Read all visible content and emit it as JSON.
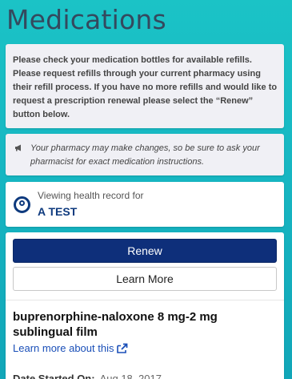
{
  "page": {
    "title": "Medications"
  },
  "notice": {
    "text": "Please check your medication bottles for available refills. Please request refills through your current pharmacy using their refill process. If you have no more refills and would like to request a prescription renewal please select the “Renew” button below."
  },
  "pharmacy_note": {
    "icon": "megaphone-icon",
    "text": "Your pharmacy may make changes, so be sure to ask your pharmacist for exact medication instructions."
  },
  "health_record": {
    "label": "Viewing health record for",
    "name": "A TEST",
    "icon": "user-circle-icon"
  },
  "medication": {
    "renew_label": "Renew",
    "learn_more_label": "Learn More",
    "name": "buprenorphine-naloxone 8 mg-2 mg sublingual film",
    "learn_link": "Learn more about this",
    "date_started_label": "Date Started On:",
    "date_started_value": "Aug 18, 2017"
  },
  "colors": {
    "accent": "#0e2f7a",
    "background_teal": "#1bc3c6",
    "link": "#1a4fb8"
  }
}
